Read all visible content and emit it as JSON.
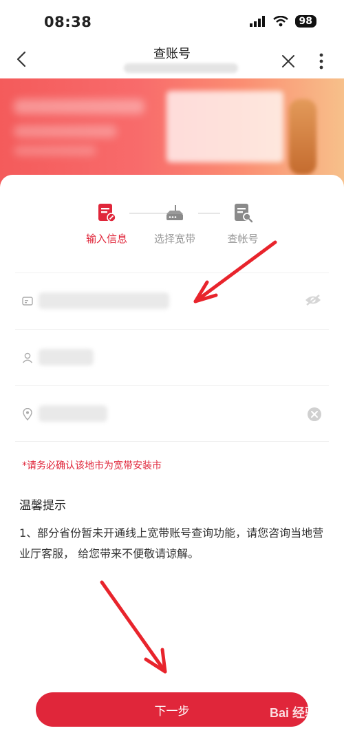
{
  "status_bar": {
    "time": "08:38",
    "battery": "98"
  },
  "nav": {
    "title": "查账号"
  },
  "steps": [
    {
      "label": "输入信息",
      "icon": "form-edit-icon",
      "active": true
    },
    {
      "label": "选择宽带",
      "icon": "router-icon",
      "active": false
    },
    {
      "label": "查帐号",
      "icon": "document-search-icon",
      "active": false
    }
  ],
  "form": {
    "fields": [
      {
        "icon": "id-card-icon",
        "action_icon": "eye-hidden-icon"
      },
      {
        "icon": "user-icon",
        "action_icon": ""
      },
      {
        "icon": "location-pin-icon",
        "action_icon": "clear-icon"
      }
    ]
  },
  "warning_text": "*请务必确认该地市为宽带安装市",
  "tips": {
    "title": "温馨提示",
    "body": "1、部分省份暂未开通线上宽带账号查询功能，请您咨询当地营业厅客服， 给您带来不便敬请谅解。"
  },
  "next_button": {
    "label": "下一步"
  },
  "watermark": "Bai 经验",
  "colors": {
    "accent": "#e0263a",
    "banner_start": "#f45b5b",
    "banner_end": "#f7c08a"
  }
}
